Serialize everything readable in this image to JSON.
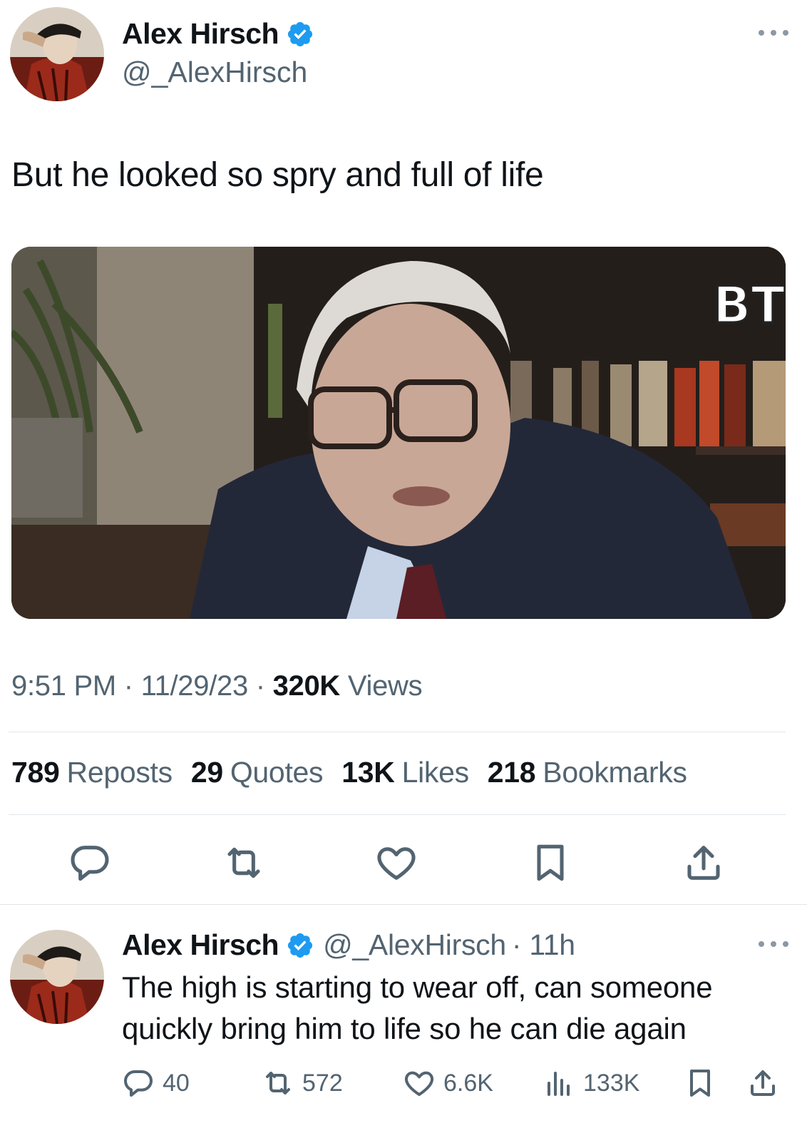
{
  "tweet": {
    "author_name": "Alex Hirsch",
    "author_handle": "@_AlexHirsch",
    "text": "But he looked so spry and full of life",
    "media_logo": "BT",
    "time": "9:51 PM",
    "date": "11/29/23",
    "views_count": "320K",
    "views_label": "Views",
    "sep": "·"
  },
  "stats": [
    {
      "num": "789",
      "label": "Reposts"
    },
    {
      "num": "29",
      "label": "Quotes"
    },
    {
      "num": "13K",
      "label": "Likes"
    },
    {
      "num": "218",
      "label": "Bookmarks"
    }
  ],
  "actions": {
    "icons": [
      "reply-icon",
      "repost-icon",
      "like-icon",
      "bookmark-icon",
      "share-icon"
    ]
  },
  "reply": {
    "author_name": "Alex Hirsch",
    "author_handle": "@_AlexHirsch",
    "age": "· 11h",
    "text": "The high is starting to wear off, can someone quickly bring him to life so he can die again",
    "replies": "40",
    "reposts": "572",
    "likes": "6.6K",
    "views": "133K"
  },
  "colors": {
    "verified": "#1d9bf0",
    "secondary_text": "#536471",
    "icon": "#536471"
  }
}
